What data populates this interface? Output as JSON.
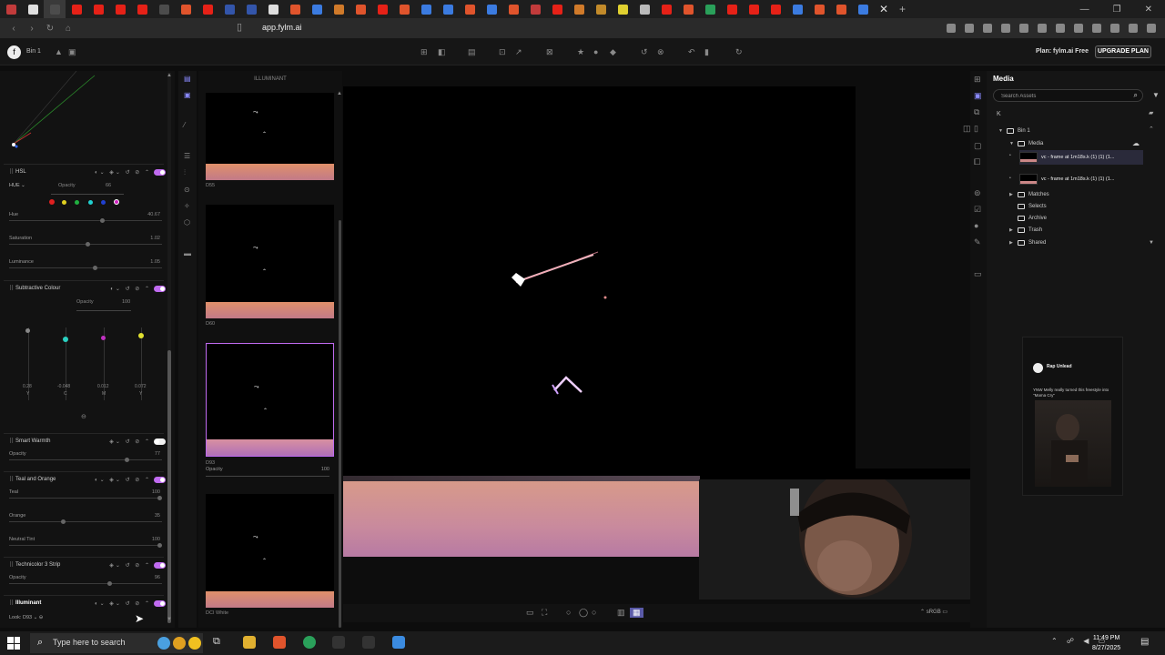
{
  "browser": {
    "url": "app.fylm.ai",
    "tab_close": "✕",
    "new_tab": "+",
    "tab_colors": [
      "#c23b3b",
      "#e0e0e0",
      "#4c4c4c",
      "#e62117",
      "#e62117",
      "#e62117",
      "#e62117",
      "#4c4c4c",
      "#e0542c",
      "#e62117",
      "#3355aa",
      "#3355aa",
      "#ddd",
      "#e0542c",
      "#3b7be0",
      "#d07a2a",
      "#e0542c",
      "#e62117",
      "#e0542c",
      "#3b7be0",
      "#3b7be0",
      "#e0542c",
      "#3b7be0",
      "#e0542c",
      "#c23b3b",
      "#e62117",
      "#d07a2a",
      "#c28a2a",
      "#e0d030",
      "#bbbbbb",
      "#e62117",
      "#e0542c",
      "#2aa05a",
      "#e62117",
      "#e62117",
      "#e62117",
      "#3b7be0",
      "#e0542c",
      "#e0542c",
      "#3b7be0"
    ],
    "window_controls": [
      "—",
      "❐",
      "✕"
    ]
  },
  "app": {
    "logo": "f",
    "project_name": "Bin 1",
    "plan_label": "Plan: fylm.ai Free",
    "upgrade_label": "UPGRADE PLAN",
    "toolbar_icons": [
      "grid-icon",
      "compare-icon",
      "folder-icon",
      "crop-icon",
      "share-icon",
      "export-icon",
      "star-icon",
      "circle-icon",
      "tag-icon",
      "reset-icon",
      "bookmark-icon",
      "undo-icon",
      "delete-icon",
      "redo-icon"
    ]
  },
  "layers": {
    "hsl": {
      "name": "HSL",
      "mode": "HUE",
      "opacity_label": "Opacity",
      "opacity_val": "66",
      "hue_label": "Hue",
      "hue_val": "40.67",
      "sat_label": "Saturation",
      "sat_val": "1.02",
      "lum_label": "Luminance",
      "lum_val": "1.05"
    },
    "subtractive": {
      "name": "Subtractive Colour",
      "opacity_label": "Opacity",
      "opacity_val": "100",
      "vals": [
        "0.28",
        "-0.048",
        "0.012",
        "0.072"
      ],
      "letters": [
        "Y",
        "C",
        "M",
        "Y"
      ]
    },
    "smart_warmth": {
      "name": "Smart Warmth",
      "opacity_label": "Opacity",
      "opacity_val": "77"
    },
    "teal_orange": {
      "name": "Teal and Orange",
      "teal_label": "Teal",
      "teal_val": "100",
      "orange_label": "Orange",
      "orange_val": "35",
      "tint_label": "Neutral Tint",
      "tint_val": "100"
    },
    "technicolor": {
      "name": "Technicolor 3 Strip",
      "opacity_label": "Opacity",
      "opacity_val": "96"
    },
    "illuminant": {
      "name": "Illuminant",
      "look_label": "Look: D93"
    }
  },
  "thumbs": {
    "header": "ILLUMINANT",
    "items": [
      {
        "label": "D55"
      },
      {
        "label": "D60"
      },
      {
        "label": "D93",
        "selected": true
      },
      {
        "label": "DCI White"
      }
    ],
    "opacity_label": "Opacity",
    "opacity_val": "100"
  },
  "viewer": {
    "color_space": "sRGB"
  },
  "media": {
    "title": "Media",
    "search_placeholder": "Search Assets",
    "filter_label": "K",
    "tree": [
      {
        "label": "Bin 1",
        "level": 0
      },
      {
        "label": "Media",
        "level": 1
      },
      {
        "label": "Matches",
        "level": 1
      },
      {
        "label": "Selects",
        "level": 1
      },
      {
        "label": "Archive",
        "level": 1
      },
      {
        "label": "Trash",
        "level": 1
      },
      {
        "label": "Shared",
        "level": 1
      }
    ],
    "clips": [
      {
        "name": "vc - frame at 1m18s.k (1) (1) (1...",
        "selected": true
      },
      {
        "name": "vc - frame at 1m18s.k (1) (1) (1...",
        "selected": false
      }
    ]
  },
  "social_post": {
    "name": "Rap Unlead",
    "text": "YNW Melly really turned this freestyle into \"Mama Cry\""
  },
  "taskbar": {
    "search_placeholder": "Type here to search",
    "time": "11:49 PM",
    "date": "8/27/2025",
    "app_colors": [
      "#ccc",
      "#e0a020",
      "#e0542c",
      "#2aa05a",
      "#ddd",
      "#ddd",
      "#3b8be0"
    ]
  }
}
